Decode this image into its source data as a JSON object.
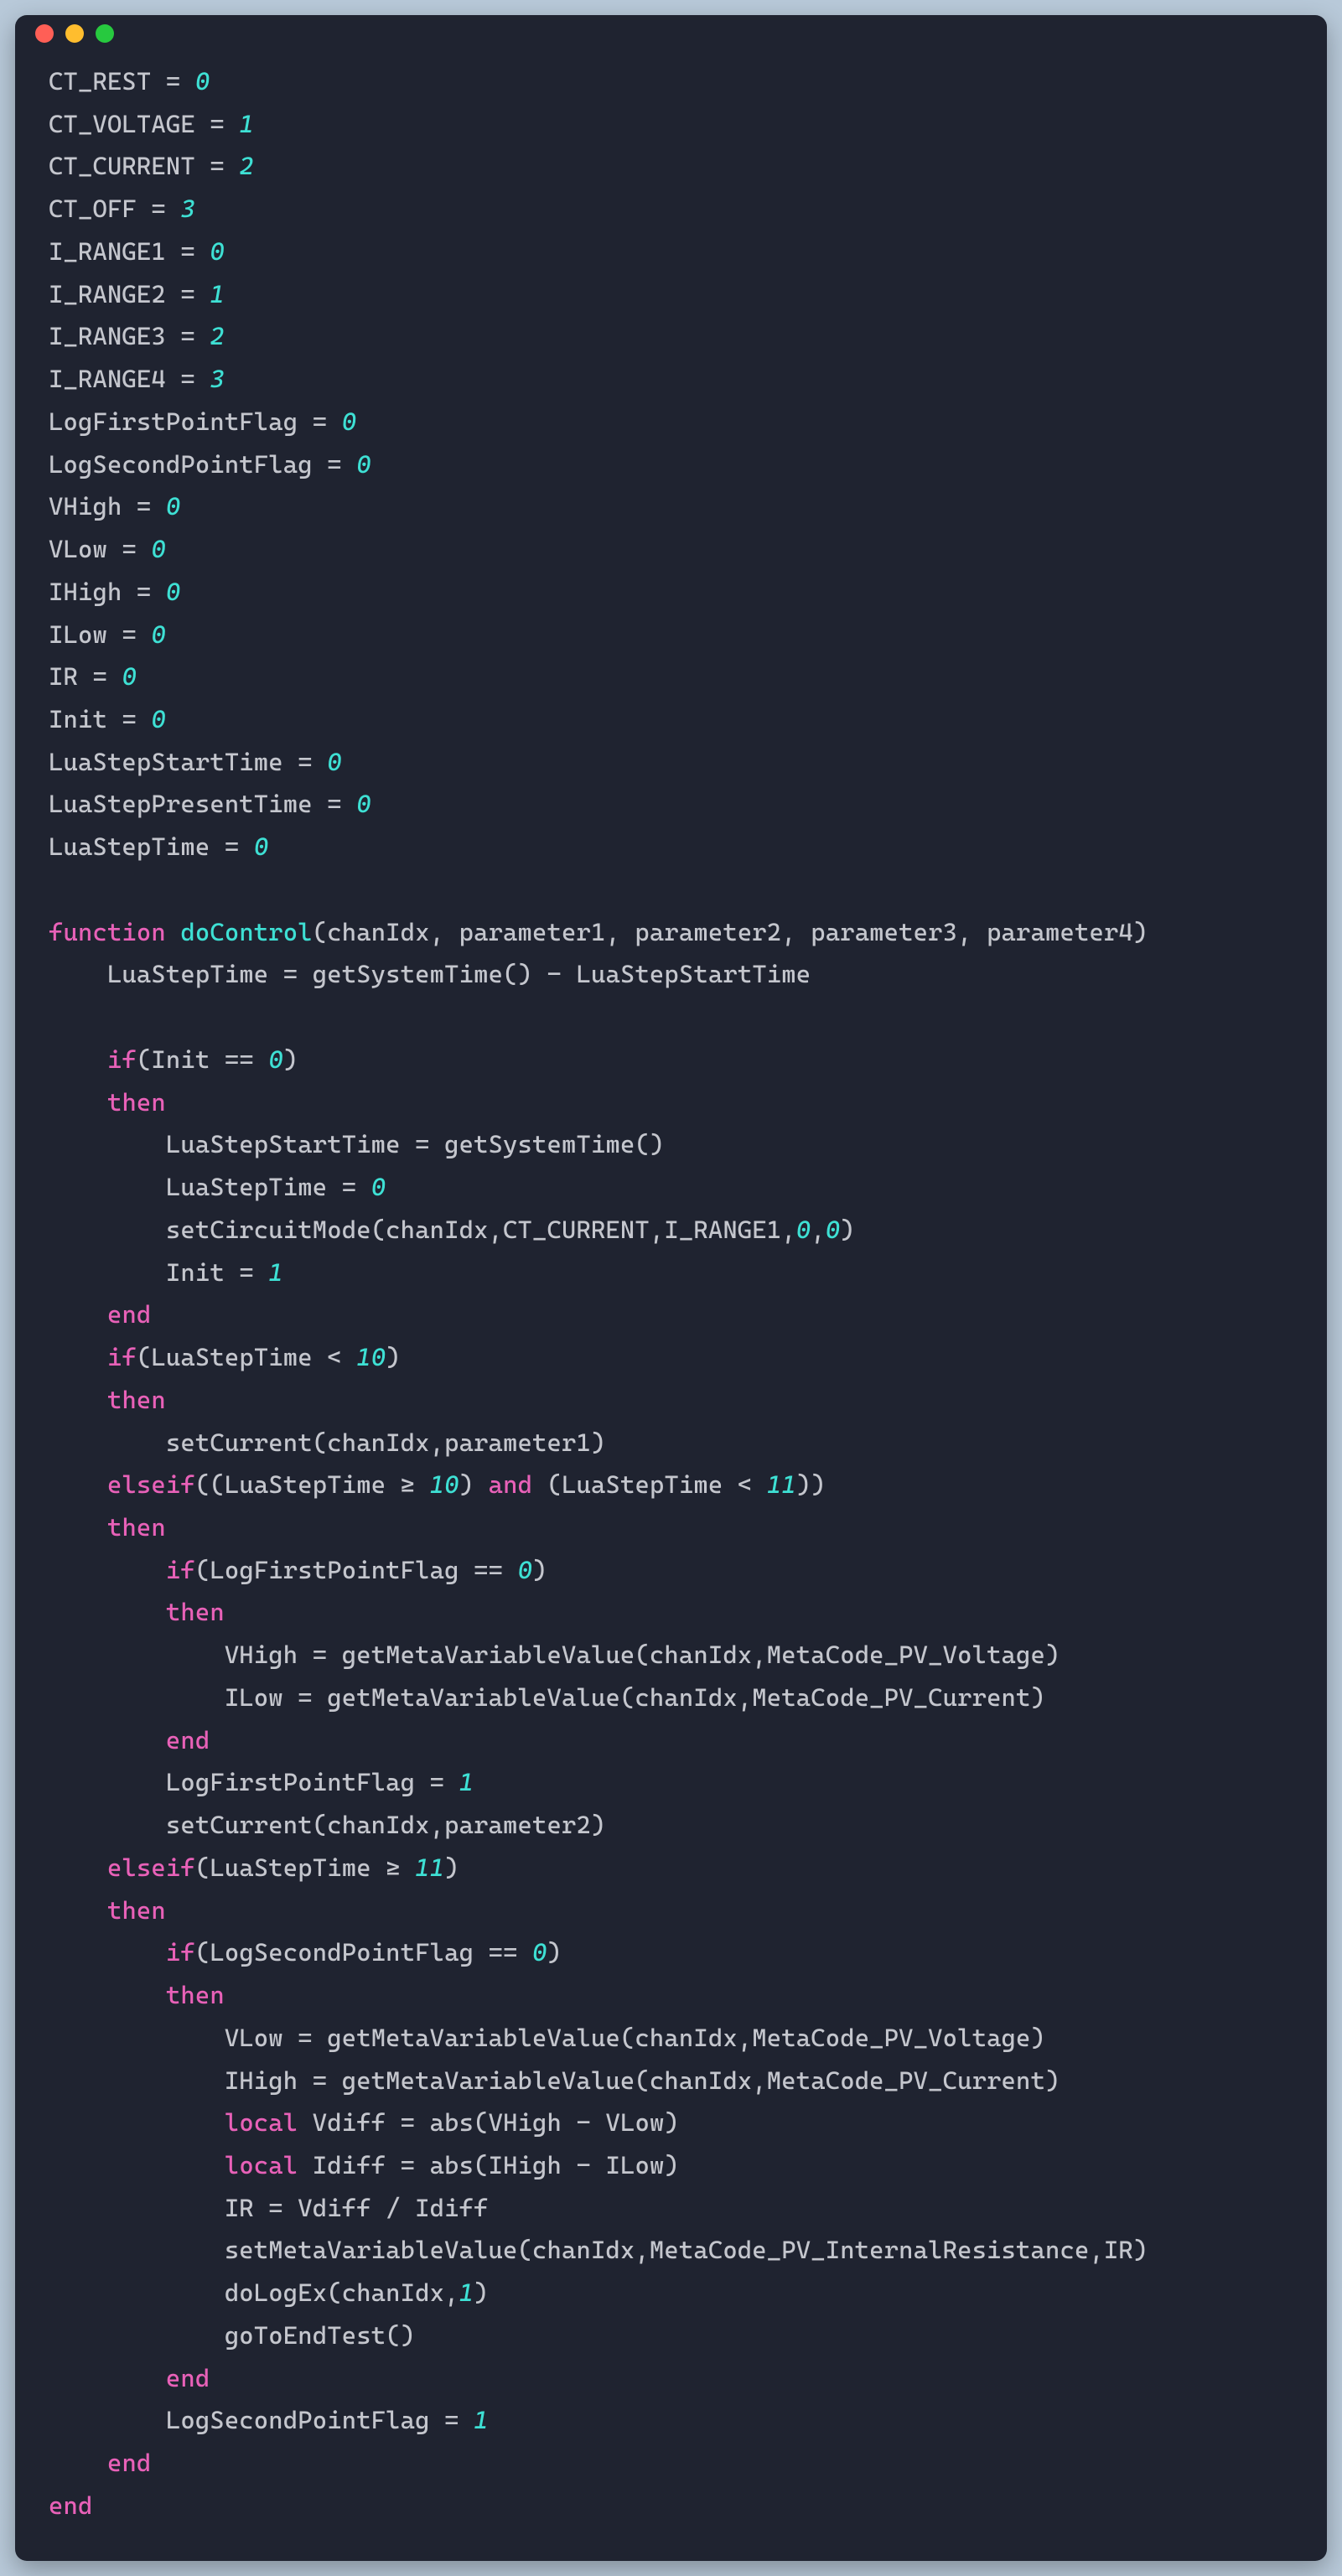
{
  "code": {
    "lines": [
      [
        [
          "tk-default",
          "CT_REST "
        ],
        [
          "tk-op",
          "= "
        ],
        [
          "tk-num",
          "0"
        ]
      ],
      [
        [
          "tk-default",
          "CT_VOLTAGE "
        ],
        [
          "tk-op",
          "= "
        ],
        [
          "tk-num",
          "1"
        ]
      ],
      [
        [
          "tk-default",
          "CT_CURRENT "
        ],
        [
          "tk-op",
          "= "
        ],
        [
          "tk-num",
          "2"
        ]
      ],
      [
        [
          "tk-default",
          "CT_OFF "
        ],
        [
          "tk-op",
          "= "
        ],
        [
          "tk-num",
          "3"
        ]
      ],
      [
        [
          "tk-default",
          "I_RANGE1 "
        ],
        [
          "tk-op",
          "= "
        ],
        [
          "tk-num",
          "0"
        ]
      ],
      [
        [
          "tk-default",
          "I_RANGE2 "
        ],
        [
          "tk-op",
          "= "
        ],
        [
          "tk-num",
          "1"
        ]
      ],
      [
        [
          "tk-default",
          "I_RANGE3 "
        ],
        [
          "tk-op",
          "= "
        ],
        [
          "tk-num",
          "2"
        ]
      ],
      [
        [
          "tk-default",
          "I_RANGE4 "
        ],
        [
          "tk-op",
          "= "
        ],
        [
          "tk-num",
          "3"
        ]
      ],
      [
        [
          "tk-default",
          "LogFirstPointFlag "
        ],
        [
          "tk-op",
          "= "
        ],
        [
          "tk-num",
          "0"
        ]
      ],
      [
        [
          "tk-default",
          "LogSecondPointFlag "
        ],
        [
          "tk-op",
          "= "
        ],
        [
          "tk-num",
          "0"
        ]
      ],
      [
        [
          "tk-default",
          "VHigh "
        ],
        [
          "tk-op",
          "= "
        ],
        [
          "tk-num",
          "0"
        ]
      ],
      [
        [
          "tk-default",
          "VLow "
        ],
        [
          "tk-op",
          "= "
        ],
        [
          "tk-num",
          "0"
        ]
      ],
      [
        [
          "tk-default",
          "IHigh "
        ],
        [
          "tk-op",
          "= "
        ],
        [
          "tk-num",
          "0"
        ]
      ],
      [
        [
          "tk-default",
          "ILow "
        ],
        [
          "tk-op",
          "= "
        ],
        [
          "tk-num",
          "0"
        ]
      ],
      [
        [
          "tk-default",
          "IR "
        ],
        [
          "tk-op",
          "= "
        ],
        [
          "tk-num",
          "0"
        ]
      ],
      [
        [
          "tk-default",
          "Init "
        ],
        [
          "tk-op",
          "= "
        ],
        [
          "tk-num",
          "0"
        ]
      ],
      [
        [
          "tk-default",
          "LuaStepStartTime "
        ],
        [
          "tk-op",
          "= "
        ],
        [
          "tk-num",
          "0"
        ]
      ],
      [
        [
          "tk-default",
          "LuaStepPresentTime "
        ],
        [
          "tk-op",
          "= "
        ],
        [
          "tk-num",
          "0"
        ]
      ],
      [
        [
          "tk-default",
          "LuaStepTime "
        ],
        [
          "tk-op",
          "= "
        ],
        [
          "tk-num",
          "0"
        ]
      ],
      [
        [
          "tk-default",
          ""
        ]
      ],
      [
        [
          "tk-kw",
          "function "
        ],
        [
          "tk-fn",
          "doControl"
        ],
        [
          "tk-default",
          "(chanIdx, parameter1, parameter2, parameter3, parameter4)"
        ]
      ],
      [
        [
          "tk-default",
          "    LuaStepTime "
        ],
        [
          "tk-op",
          "= "
        ],
        [
          "tk-default",
          "getSystemTime() "
        ],
        [
          "tk-op",
          "- "
        ],
        [
          "tk-default",
          "LuaStepStartTime"
        ]
      ],
      [
        [
          "tk-default",
          ""
        ]
      ],
      [
        [
          "tk-default",
          "    "
        ],
        [
          "tk-kw",
          "if"
        ],
        [
          "tk-default",
          "(Init "
        ],
        [
          "tk-op",
          "== "
        ],
        [
          "tk-num",
          "0"
        ],
        [
          "tk-default",
          ")"
        ]
      ],
      [
        [
          "tk-default",
          "    "
        ],
        [
          "tk-kw",
          "then"
        ]
      ],
      [
        [
          "tk-default",
          "        LuaStepStartTime "
        ],
        [
          "tk-op",
          "= "
        ],
        [
          "tk-default",
          "getSystemTime()"
        ]
      ],
      [
        [
          "tk-default",
          "        LuaStepTime "
        ],
        [
          "tk-op",
          "= "
        ],
        [
          "tk-num",
          "0"
        ]
      ],
      [
        [
          "tk-default",
          "        setCircuitMode(chanIdx,CT_CURRENT,I_RANGE1,"
        ],
        [
          "tk-num",
          "0"
        ],
        [
          "tk-default",
          ","
        ],
        [
          "tk-num",
          "0"
        ],
        [
          "tk-default",
          ")"
        ]
      ],
      [
        [
          "tk-default",
          "        Init "
        ],
        [
          "tk-op",
          "= "
        ],
        [
          "tk-num",
          "1"
        ]
      ],
      [
        [
          "tk-default",
          "    "
        ],
        [
          "tk-kw",
          "end"
        ]
      ],
      [
        [
          "tk-default",
          "    "
        ],
        [
          "tk-kw",
          "if"
        ],
        [
          "tk-default",
          "(LuaStepTime "
        ],
        [
          "tk-op",
          "< "
        ],
        [
          "tk-num",
          "10"
        ],
        [
          "tk-default",
          ")"
        ]
      ],
      [
        [
          "tk-default",
          "    "
        ],
        [
          "tk-kw",
          "then"
        ]
      ],
      [
        [
          "tk-default",
          "        setCurrent(chanIdx,parameter1)"
        ]
      ],
      [
        [
          "tk-default",
          "    "
        ],
        [
          "tk-kw",
          "elseif"
        ],
        [
          "tk-default",
          "((LuaStepTime "
        ],
        [
          "tk-op",
          "≥ "
        ],
        [
          "tk-num",
          "10"
        ],
        [
          "tk-default",
          ") "
        ],
        [
          "tk-kw",
          "and"
        ],
        [
          "tk-default",
          " (LuaStepTime "
        ],
        [
          "tk-op",
          "< "
        ],
        [
          "tk-num",
          "11"
        ],
        [
          "tk-default",
          "))"
        ]
      ],
      [
        [
          "tk-default",
          "    "
        ],
        [
          "tk-kw",
          "then"
        ]
      ],
      [
        [
          "tk-default",
          "        "
        ],
        [
          "tk-kw",
          "if"
        ],
        [
          "tk-default",
          "(LogFirstPointFlag "
        ],
        [
          "tk-op",
          "== "
        ],
        [
          "tk-num",
          "0"
        ],
        [
          "tk-default",
          ")"
        ]
      ],
      [
        [
          "tk-default",
          "        "
        ],
        [
          "tk-kw",
          "then"
        ]
      ],
      [
        [
          "tk-default",
          "            VHigh "
        ],
        [
          "tk-op",
          "= "
        ],
        [
          "tk-default",
          "getMetaVariableValue(chanIdx,MetaCode_PV_Voltage)"
        ]
      ],
      [
        [
          "tk-default",
          "            ILow "
        ],
        [
          "tk-op",
          "= "
        ],
        [
          "tk-default",
          "getMetaVariableValue(chanIdx,MetaCode_PV_Current)"
        ]
      ],
      [
        [
          "tk-default",
          "        "
        ],
        [
          "tk-kw",
          "end"
        ]
      ],
      [
        [
          "tk-default",
          "        LogFirstPointFlag "
        ],
        [
          "tk-op",
          "= "
        ],
        [
          "tk-num",
          "1"
        ]
      ],
      [
        [
          "tk-default",
          "        setCurrent(chanIdx,parameter2)"
        ]
      ],
      [
        [
          "tk-default",
          "    "
        ],
        [
          "tk-kw",
          "elseif"
        ],
        [
          "tk-default",
          "(LuaStepTime "
        ],
        [
          "tk-op",
          "≥ "
        ],
        [
          "tk-num",
          "11"
        ],
        [
          "tk-default",
          ")"
        ]
      ],
      [
        [
          "tk-default",
          "    "
        ],
        [
          "tk-kw",
          "then"
        ]
      ],
      [
        [
          "tk-default",
          "        "
        ],
        [
          "tk-kw",
          "if"
        ],
        [
          "tk-default",
          "(LogSecondPointFlag "
        ],
        [
          "tk-op",
          "== "
        ],
        [
          "tk-num",
          "0"
        ],
        [
          "tk-default",
          ")"
        ]
      ],
      [
        [
          "tk-default",
          "        "
        ],
        [
          "tk-kw",
          "then"
        ]
      ],
      [
        [
          "tk-default",
          "            VLow "
        ],
        [
          "tk-op",
          "= "
        ],
        [
          "tk-default",
          "getMetaVariableValue(chanIdx,MetaCode_PV_Voltage)"
        ]
      ],
      [
        [
          "tk-default",
          "            IHigh "
        ],
        [
          "tk-op",
          "= "
        ],
        [
          "tk-default",
          "getMetaVariableValue(chanIdx,MetaCode_PV_Current)"
        ]
      ],
      [
        [
          "tk-default",
          "            "
        ],
        [
          "tk-kw",
          "local"
        ],
        [
          "tk-default",
          " Vdiff "
        ],
        [
          "tk-op",
          "= "
        ],
        [
          "tk-default",
          "abs(VHigh "
        ],
        [
          "tk-op",
          "- "
        ],
        [
          "tk-default",
          "VLow)"
        ]
      ],
      [
        [
          "tk-default",
          "            "
        ],
        [
          "tk-kw",
          "local"
        ],
        [
          "tk-default",
          " Idiff "
        ],
        [
          "tk-op",
          "= "
        ],
        [
          "tk-default",
          "abs(IHigh "
        ],
        [
          "tk-op",
          "- "
        ],
        [
          "tk-default",
          "ILow)"
        ]
      ],
      [
        [
          "tk-default",
          "            IR "
        ],
        [
          "tk-op",
          "= "
        ],
        [
          "tk-default",
          "Vdiff "
        ],
        [
          "tk-op",
          "/ "
        ],
        [
          "tk-default",
          "Idiff"
        ]
      ],
      [
        [
          "tk-default",
          "            setMetaVariableValue(chanIdx,MetaCode_PV_InternalResistance,IR)"
        ]
      ],
      [
        [
          "tk-default",
          "            doLogEx(chanIdx,"
        ],
        [
          "tk-num",
          "1"
        ],
        [
          "tk-default",
          ")"
        ]
      ],
      [
        [
          "tk-default",
          "            goToEndTest()"
        ]
      ],
      [
        [
          "tk-default",
          "        "
        ],
        [
          "tk-kw",
          "end"
        ]
      ],
      [
        [
          "tk-default",
          "        LogSecondPointFlag "
        ],
        [
          "tk-op",
          "= "
        ],
        [
          "tk-num",
          "1"
        ]
      ],
      [
        [
          "tk-default",
          "    "
        ],
        [
          "tk-kw",
          "end"
        ]
      ],
      [
        [
          "tk-kw",
          "end"
        ]
      ]
    ]
  }
}
